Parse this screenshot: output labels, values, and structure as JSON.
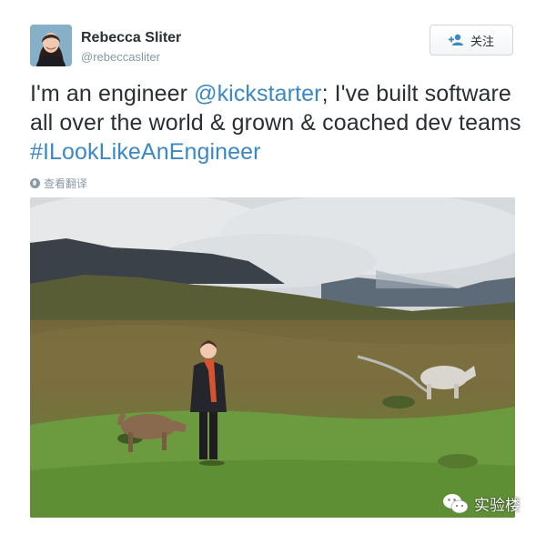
{
  "author": {
    "name": "Rebecca Sliter",
    "handle": "@rebeccasliter",
    "avatar_icon": "person-photo-icon"
  },
  "follow_button": {
    "label": "关注",
    "icon": "add-user-icon"
  },
  "tweet": {
    "text_parts": {
      "p1": "I'm an engineer ",
      "mention": "@kickstarter",
      "p2": "; I've built software all over the world & grown & coached dev teams ",
      "hashtag": "#ILookLikeAnEngineer"
    },
    "link_color": "#3b88c3"
  },
  "translate": {
    "label": "查看翻译",
    "icon": "globe-icon"
  },
  "photo": {
    "icon": "landscape-photo"
  },
  "watermark": {
    "label": "实验楼",
    "icon": "wechat-icon"
  }
}
